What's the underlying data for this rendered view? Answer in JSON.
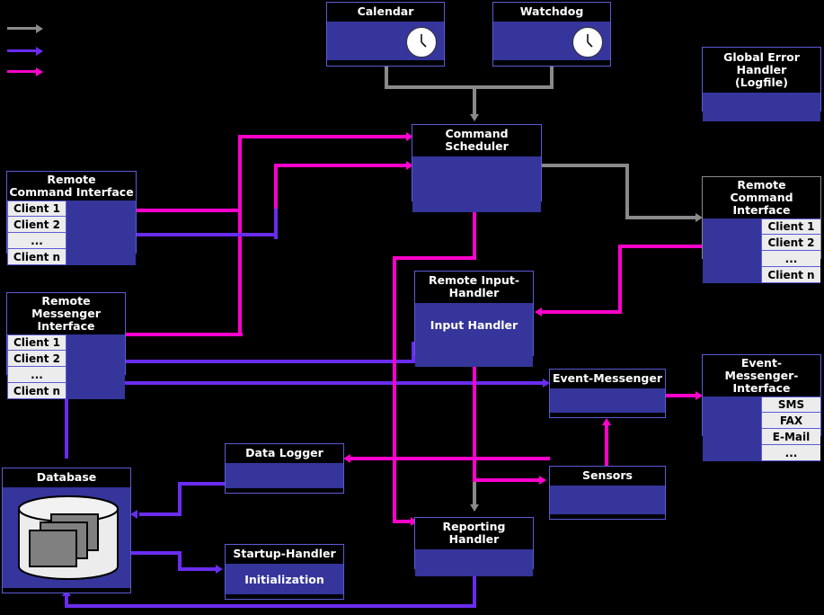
{
  "diagram": {
    "title": "System Architecture Block Diagram",
    "background": "#000000",
    "palette": {
      "box_body": "#35359b",
      "box_border": "#5b5bd6",
      "cell_bg": "#ececec",
      "flow_gray": "#8a8a8a",
      "flow_blue": "#6a2cf0",
      "flow_magenta": "#ff00cc"
    }
  },
  "legend": {
    "items": [
      {
        "name": "gray-arrow",
        "color": "#8a8a8a",
        "label": ""
      },
      {
        "name": "blue-arrow",
        "color": "#6a2cf0",
        "label": ""
      },
      {
        "name": "magenta-arrow",
        "color": "#ff00cc",
        "label": ""
      }
    ]
  },
  "nodes": {
    "calendar": {
      "title": "Calendar",
      "icon": "clock-icon"
    },
    "watchdog": {
      "title": "Watchdog",
      "icon": "clock-icon"
    },
    "global_error_handler": {
      "title_line1": "Global Error Handler",
      "title_line2": "(Logfile)"
    },
    "command_scheduler": {
      "title": "Command Scheduler"
    },
    "remote_command_interface_left": {
      "title_line1": "Remote",
      "title_line2": "Command Interface",
      "clients": [
        "Client 1",
        "Client 2",
        "...",
        "Client n"
      ]
    },
    "remote_command_interface_right": {
      "title_line1": "Remote",
      "title_line2": "Command Interface",
      "clients": [
        "Client 1",
        "Client 2",
        "...",
        "Client n"
      ]
    },
    "remote_messenger_interface": {
      "title_line1": "Remote",
      "title_line2": "Messenger Interface",
      "clients": [
        "Client 1",
        "Client 2",
        "...",
        "Client n"
      ]
    },
    "remote_input_handler": {
      "title": "Remote Input-Handler",
      "body_label": "Input Handler"
    },
    "event_messenger": {
      "title": "Event-Messenger"
    },
    "event_messenger_interface": {
      "title_line1": "Event-Messenger-",
      "title_line2": "Interface",
      "channels": [
        "SMS",
        "FAX",
        "E-Mail",
        "..."
      ]
    },
    "data_logger": {
      "title": "Data Logger"
    },
    "database": {
      "title": "Database",
      "icon": "database-cylinder-icon"
    },
    "startup_handler": {
      "title": "Startup-Handler",
      "body_label": "Initialization"
    },
    "reporting_handler": {
      "title": "Reporting Handler"
    },
    "sensors": {
      "title": "Sensors"
    }
  }
}
